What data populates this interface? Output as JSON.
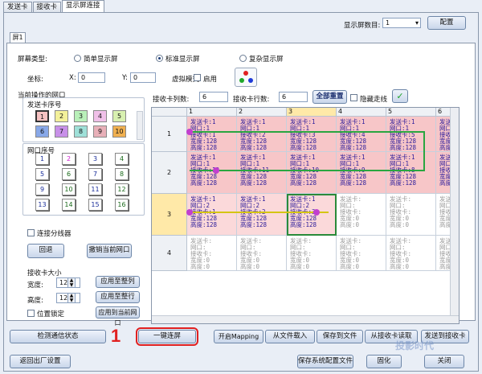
{
  "tabs": [
    "发送卡",
    "接收卡",
    "显示屏连接"
  ],
  "top": {
    "screen_count_label": "显示屏数目:",
    "screen_count_value": "1",
    "config_button": "配置"
  },
  "inner_tab": "屏1",
  "screen_type": {
    "label": "屏幕类型:",
    "options": [
      "简单显示屏",
      "标准显示屏",
      "复杂显示屏"
    ],
    "selected": "标准显示屏"
  },
  "coords": {
    "label": "坐标:",
    "x_label": "X:",
    "x_value": "0",
    "y_label": "Y:",
    "y_value": "0"
  },
  "virtual": {
    "label": "虚拟模式:",
    "enable_label": "启用"
  },
  "net_group": {
    "title": "当前操作的网口",
    "card_label": "发送卡序号",
    "card_numbers": [
      "1",
      "2",
      "3",
      "4",
      "5",
      "6",
      "7",
      "8",
      "9",
      "10"
    ],
    "port_label": "网口序号",
    "port_numbers": [
      "1",
      "2",
      "3",
      "4",
      "5",
      "6",
      "7",
      "8",
      "9",
      "10",
      "11",
      "12",
      "13",
      "14",
      "15",
      "16"
    ]
  },
  "receiver_cols": {
    "label": "接收卡列数:",
    "value": "6"
  },
  "receiver_rows": {
    "label": "接收卡行数:",
    "value": "6"
  },
  "full_reset": "全部重置",
  "hide_lines": "隐藏走线",
  "connect_split": "连接分线器",
  "back_button": "回退",
  "undo_port_button": "撤销当前网口",
  "receiver_size": {
    "title": "接收卡大小",
    "width_label": "宽度:",
    "width_value": "128",
    "height_label": "高度:",
    "height_value": "128",
    "apply_col": "应用至整列",
    "apply_row": "应用至整行",
    "apply_port": "应用到当前网口",
    "position_fixed": "位置锁定"
  },
  "grid": {
    "col_headers": [
      "1",
      "2",
      "3",
      "4",
      "5",
      "6"
    ],
    "row_headers": [
      "1",
      "2",
      "3",
      "4"
    ],
    "rows": [
      [
        {
          "lines": [
            "发送卡:1",
            "网口:1",
            "接收卡:1",
            "宽度:128",
            "高度:128"
          ],
          "state": "pink"
        },
        {
          "lines": [
            "发送卡:1",
            "网口:1",
            "接收卡:2",
            "宽度:128",
            "高度:128"
          ],
          "state": "pink"
        },
        {
          "lines": [
            "发送卡:1",
            "网口:1",
            "接收卡:3",
            "宽度:128",
            "高度:128"
          ],
          "state": "pink"
        },
        {
          "lines": [
            "发送卡:1",
            "网口:1",
            "接收卡:4",
            "宽度:128",
            "高度:128"
          ],
          "state": "pink"
        },
        {
          "lines": [
            "发送卡:1",
            "网口:1",
            "接收卡:5",
            "宽度:128",
            "高度:128"
          ],
          "state": "pink"
        },
        {
          "lines": [
            "发送卡:1",
            "网口:1",
            "接收卡:6",
            "宽度:128",
            "高度:128"
          ],
          "state": "pink"
        }
      ],
      [
        {
          "lines": [
            "发送卡:1",
            "网口:1",
            "接收卡:12",
            "宽度:128",
            "高度:128"
          ],
          "state": "pink"
        },
        {
          "lines": [
            "发送卡:1",
            "网口:1",
            "接收卡:11",
            "宽度:128",
            "高度:128"
          ],
          "state": "pink"
        },
        {
          "lines": [
            "发送卡:1",
            "网口:1",
            "接收卡:10",
            "宽度:128",
            "高度:128"
          ],
          "state": "pink"
        },
        {
          "lines": [
            "发送卡:1",
            "网口:1",
            "接收卡:9",
            "宽度:128",
            "高度:128"
          ],
          "state": "pink"
        },
        {
          "lines": [
            "发送卡:1",
            "网口:1",
            "接收卡:8",
            "宽度:128",
            "高度:128"
          ],
          "state": "pink"
        },
        {
          "lines": [
            "发送卡:1",
            "网口:1",
            "接收卡:7",
            "宽度:128",
            "高度:128"
          ],
          "state": "pink"
        }
      ],
      [
        {
          "lines": [
            "发送卡:1",
            "网口:2",
            "接收卡:1",
            "宽度:128",
            "高度:128"
          ],
          "state": "pinkl"
        },
        {
          "lines": [
            "发送卡:1",
            "网口:2",
            "接收卡:2",
            "宽度:128",
            "高度:128"
          ],
          "state": "pinkl"
        },
        {
          "lines": [
            "发送卡:1",
            "网口:2",
            "接收卡:3",
            "宽度:128",
            "高度:128"
          ],
          "state": "pinkl"
        },
        {
          "lines": [
            "发送卡:",
            "网口:",
            "接收卡:",
            "宽度:0",
            "高度:0"
          ],
          "state": "blank"
        },
        {
          "lines": [
            "发送卡:",
            "网口:",
            "接收卡:",
            "宽度:0",
            "高度:0"
          ],
          "state": "blank"
        },
        {
          "lines": [
            "发送卡:",
            "网口:",
            "接收卡:",
            "宽度:0",
            "高度:0"
          ],
          "state": "blank"
        }
      ],
      [
        {
          "lines": [
            "发送卡:",
            "网口:",
            "接收卡:",
            "宽度:0",
            "高度:0"
          ],
          "state": "blank"
        },
        {
          "lines": [
            "发送卡:",
            "网口:",
            "接收卡:",
            "宽度:0",
            "高度:0"
          ],
          "state": "blank"
        },
        {
          "lines": [
            "发送卡:",
            "网口:",
            "接收卡:",
            "宽度:0",
            "高度:0"
          ],
          "state": "blank"
        },
        {
          "lines": [
            "发送卡:",
            "网口:",
            "接收卡:",
            "宽度:0",
            "高度:0"
          ],
          "state": "blank"
        },
        {
          "lines": [
            "发送卡:",
            "网口:",
            "接收卡:",
            "宽度:0",
            "高度:0"
          ],
          "state": "blank"
        },
        {
          "lines": [
            "发送卡:",
            "网口:",
            "接收卡:",
            "宽度:0",
            "高度:0"
          ],
          "state": "blank"
        }
      ]
    ]
  },
  "bottom": {
    "detect": "检测通信状态",
    "one_click": "一键连屏",
    "mapping": "开启Mapping",
    "load_file": "从文件载入",
    "save_file": "保存到文件",
    "read_receiver": "从接收卡读取",
    "send_receiver": "发送到接收卡",
    "return_factory": "返回出厂设置",
    "save_sys": "保存系统配置文件",
    "solidify": "固化",
    "close": "关闭"
  },
  "annotation_number": "1",
  "watermark": "投影时代"
}
